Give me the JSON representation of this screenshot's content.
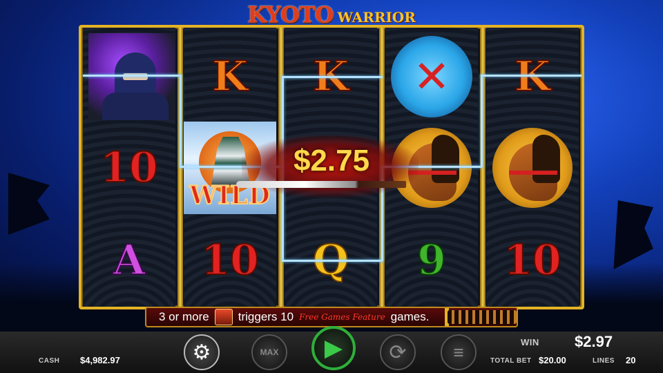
{
  "game": {
    "title_main": "KYOTO",
    "title_sub": "WARRIOR"
  },
  "reels": [
    [
      "ninja",
      "10",
      "A"
    ],
    [
      "K",
      "wild-castle",
      "10"
    ],
    [
      "K",
      "blank",
      "Q"
    ],
    [
      "kunai",
      "horse",
      "9"
    ],
    [
      "K",
      "horse",
      "10"
    ]
  ],
  "symbols": {
    "wild_text": "WILD",
    "k": "K",
    "ten": "10",
    "a": "A",
    "q": "Q",
    "nine": "9"
  },
  "win_popup": {
    "amount": "$2.75"
  },
  "feature_bar": {
    "text_before": "3 or more",
    "text_middle": "triggers 10",
    "script_text": "Free Games Feature",
    "text_after": "games."
  },
  "status": {
    "cash_label": "CASH",
    "cash_value": "$4,982.97",
    "win_label": "WIN",
    "win_value": "$2.97",
    "total_bet_label": "TOTAL BET",
    "total_bet_value": "$20.00",
    "lines_label": "LINES",
    "lines_value": "20"
  },
  "controls": {
    "max_label": "MAX"
  },
  "colors": {
    "frame_gold": "#e4b325",
    "spin_green": "#2fae3a",
    "win_gold": "#ffd84a",
    "payline": "#b8e2ff"
  }
}
